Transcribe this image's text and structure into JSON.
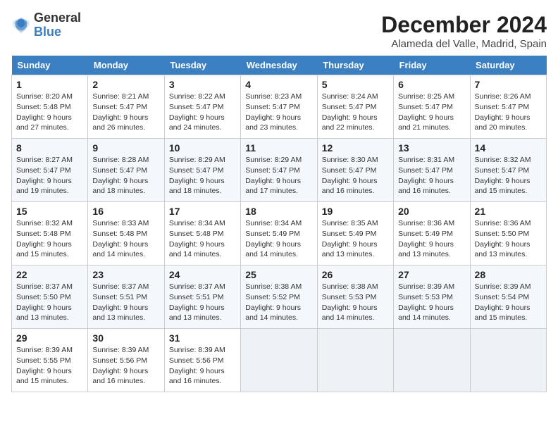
{
  "header": {
    "logo_general": "General",
    "logo_blue": "Blue",
    "title": "December 2024",
    "subtitle": "Alameda del Valle, Madrid, Spain"
  },
  "weekdays": [
    "Sunday",
    "Monday",
    "Tuesday",
    "Wednesday",
    "Thursday",
    "Friday",
    "Saturday"
  ],
  "weeks": [
    [
      {
        "day": "1",
        "sunrise": "8:20 AM",
        "sunset": "5:48 PM",
        "daylight": "9 hours and 27 minutes."
      },
      {
        "day": "2",
        "sunrise": "8:21 AM",
        "sunset": "5:47 PM",
        "daylight": "9 hours and 26 minutes."
      },
      {
        "day": "3",
        "sunrise": "8:22 AM",
        "sunset": "5:47 PM",
        "daylight": "9 hours and 24 minutes."
      },
      {
        "day": "4",
        "sunrise": "8:23 AM",
        "sunset": "5:47 PM",
        "daylight": "9 hours and 23 minutes."
      },
      {
        "day": "5",
        "sunrise": "8:24 AM",
        "sunset": "5:47 PM",
        "daylight": "9 hours and 22 minutes."
      },
      {
        "day": "6",
        "sunrise": "8:25 AM",
        "sunset": "5:47 PM",
        "daylight": "9 hours and 21 minutes."
      },
      {
        "day": "7",
        "sunrise": "8:26 AM",
        "sunset": "5:47 PM",
        "daylight": "9 hours and 20 minutes."
      }
    ],
    [
      {
        "day": "8",
        "sunrise": "8:27 AM",
        "sunset": "5:47 PM",
        "daylight": "9 hours and 19 minutes."
      },
      {
        "day": "9",
        "sunrise": "8:28 AM",
        "sunset": "5:47 PM",
        "daylight": "9 hours and 18 minutes."
      },
      {
        "day": "10",
        "sunrise": "8:29 AM",
        "sunset": "5:47 PM",
        "daylight": "9 hours and 18 minutes."
      },
      {
        "day": "11",
        "sunrise": "8:29 AM",
        "sunset": "5:47 PM",
        "daylight": "9 hours and 17 minutes."
      },
      {
        "day": "12",
        "sunrise": "8:30 AM",
        "sunset": "5:47 PM",
        "daylight": "9 hours and 16 minutes."
      },
      {
        "day": "13",
        "sunrise": "8:31 AM",
        "sunset": "5:47 PM",
        "daylight": "9 hours and 16 minutes."
      },
      {
        "day": "14",
        "sunrise": "8:32 AM",
        "sunset": "5:47 PM",
        "daylight": "9 hours and 15 minutes."
      }
    ],
    [
      {
        "day": "15",
        "sunrise": "8:32 AM",
        "sunset": "5:48 PM",
        "daylight": "9 hours and 15 minutes."
      },
      {
        "day": "16",
        "sunrise": "8:33 AM",
        "sunset": "5:48 PM",
        "daylight": "9 hours and 14 minutes."
      },
      {
        "day": "17",
        "sunrise": "8:34 AM",
        "sunset": "5:48 PM",
        "daylight": "9 hours and 14 minutes."
      },
      {
        "day": "18",
        "sunrise": "8:34 AM",
        "sunset": "5:49 PM",
        "daylight": "9 hours and 14 minutes."
      },
      {
        "day": "19",
        "sunrise": "8:35 AM",
        "sunset": "5:49 PM",
        "daylight": "9 hours and 13 minutes."
      },
      {
        "day": "20",
        "sunrise": "8:36 AM",
        "sunset": "5:49 PM",
        "daylight": "9 hours and 13 minutes."
      },
      {
        "day": "21",
        "sunrise": "8:36 AM",
        "sunset": "5:50 PM",
        "daylight": "9 hours and 13 minutes."
      }
    ],
    [
      {
        "day": "22",
        "sunrise": "8:37 AM",
        "sunset": "5:50 PM",
        "daylight": "9 hours and 13 minutes."
      },
      {
        "day": "23",
        "sunrise": "8:37 AM",
        "sunset": "5:51 PM",
        "daylight": "9 hours and 13 minutes."
      },
      {
        "day": "24",
        "sunrise": "8:37 AM",
        "sunset": "5:51 PM",
        "daylight": "9 hours and 13 minutes."
      },
      {
        "day": "25",
        "sunrise": "8:38 AM",
        "sunset": "5:52 PM",
        "daylight": "9 hours and 14 minutes."
      },
      {
        "day": "26",
        "sunrise": "8:38 AM",
        "sunset": "5:53 PM",
        "daylight": "9 hours and 14 minutes."
      },
      {
        "day": "27",
        "sunrise": "8:39 AM",
        "sunset": "5:53 PM",
        "daylight": "9 hours and 14 minutes."
      },
      {
        "day": "28",
        "sunrise": "8:39 AM",
        "sunset": "5:54 PM",
        "daylight": "9 hours and 15 minutes."
      }
    ],
    [
      {
        "day": "29",
        "sunrise": "8:39 AM",
        "sunset": "5:55 PM",
        "daylight": "9 hours and 15 minutes."
      },
      {
        "day": "30",
        "sunrise": "8:39 AM",
        "sunset": "5:56 PM",
        "daylight": "9 hours and 16 minutes."
      },
      {
        "day": "31",
        "sunrise": "8:39 AM",
        "sunset": "5:56 PM",
        "daylight": "9 hours and 16 minutes."
      },
      null,
      null,
      null,
      null
    ]
  ]
}
